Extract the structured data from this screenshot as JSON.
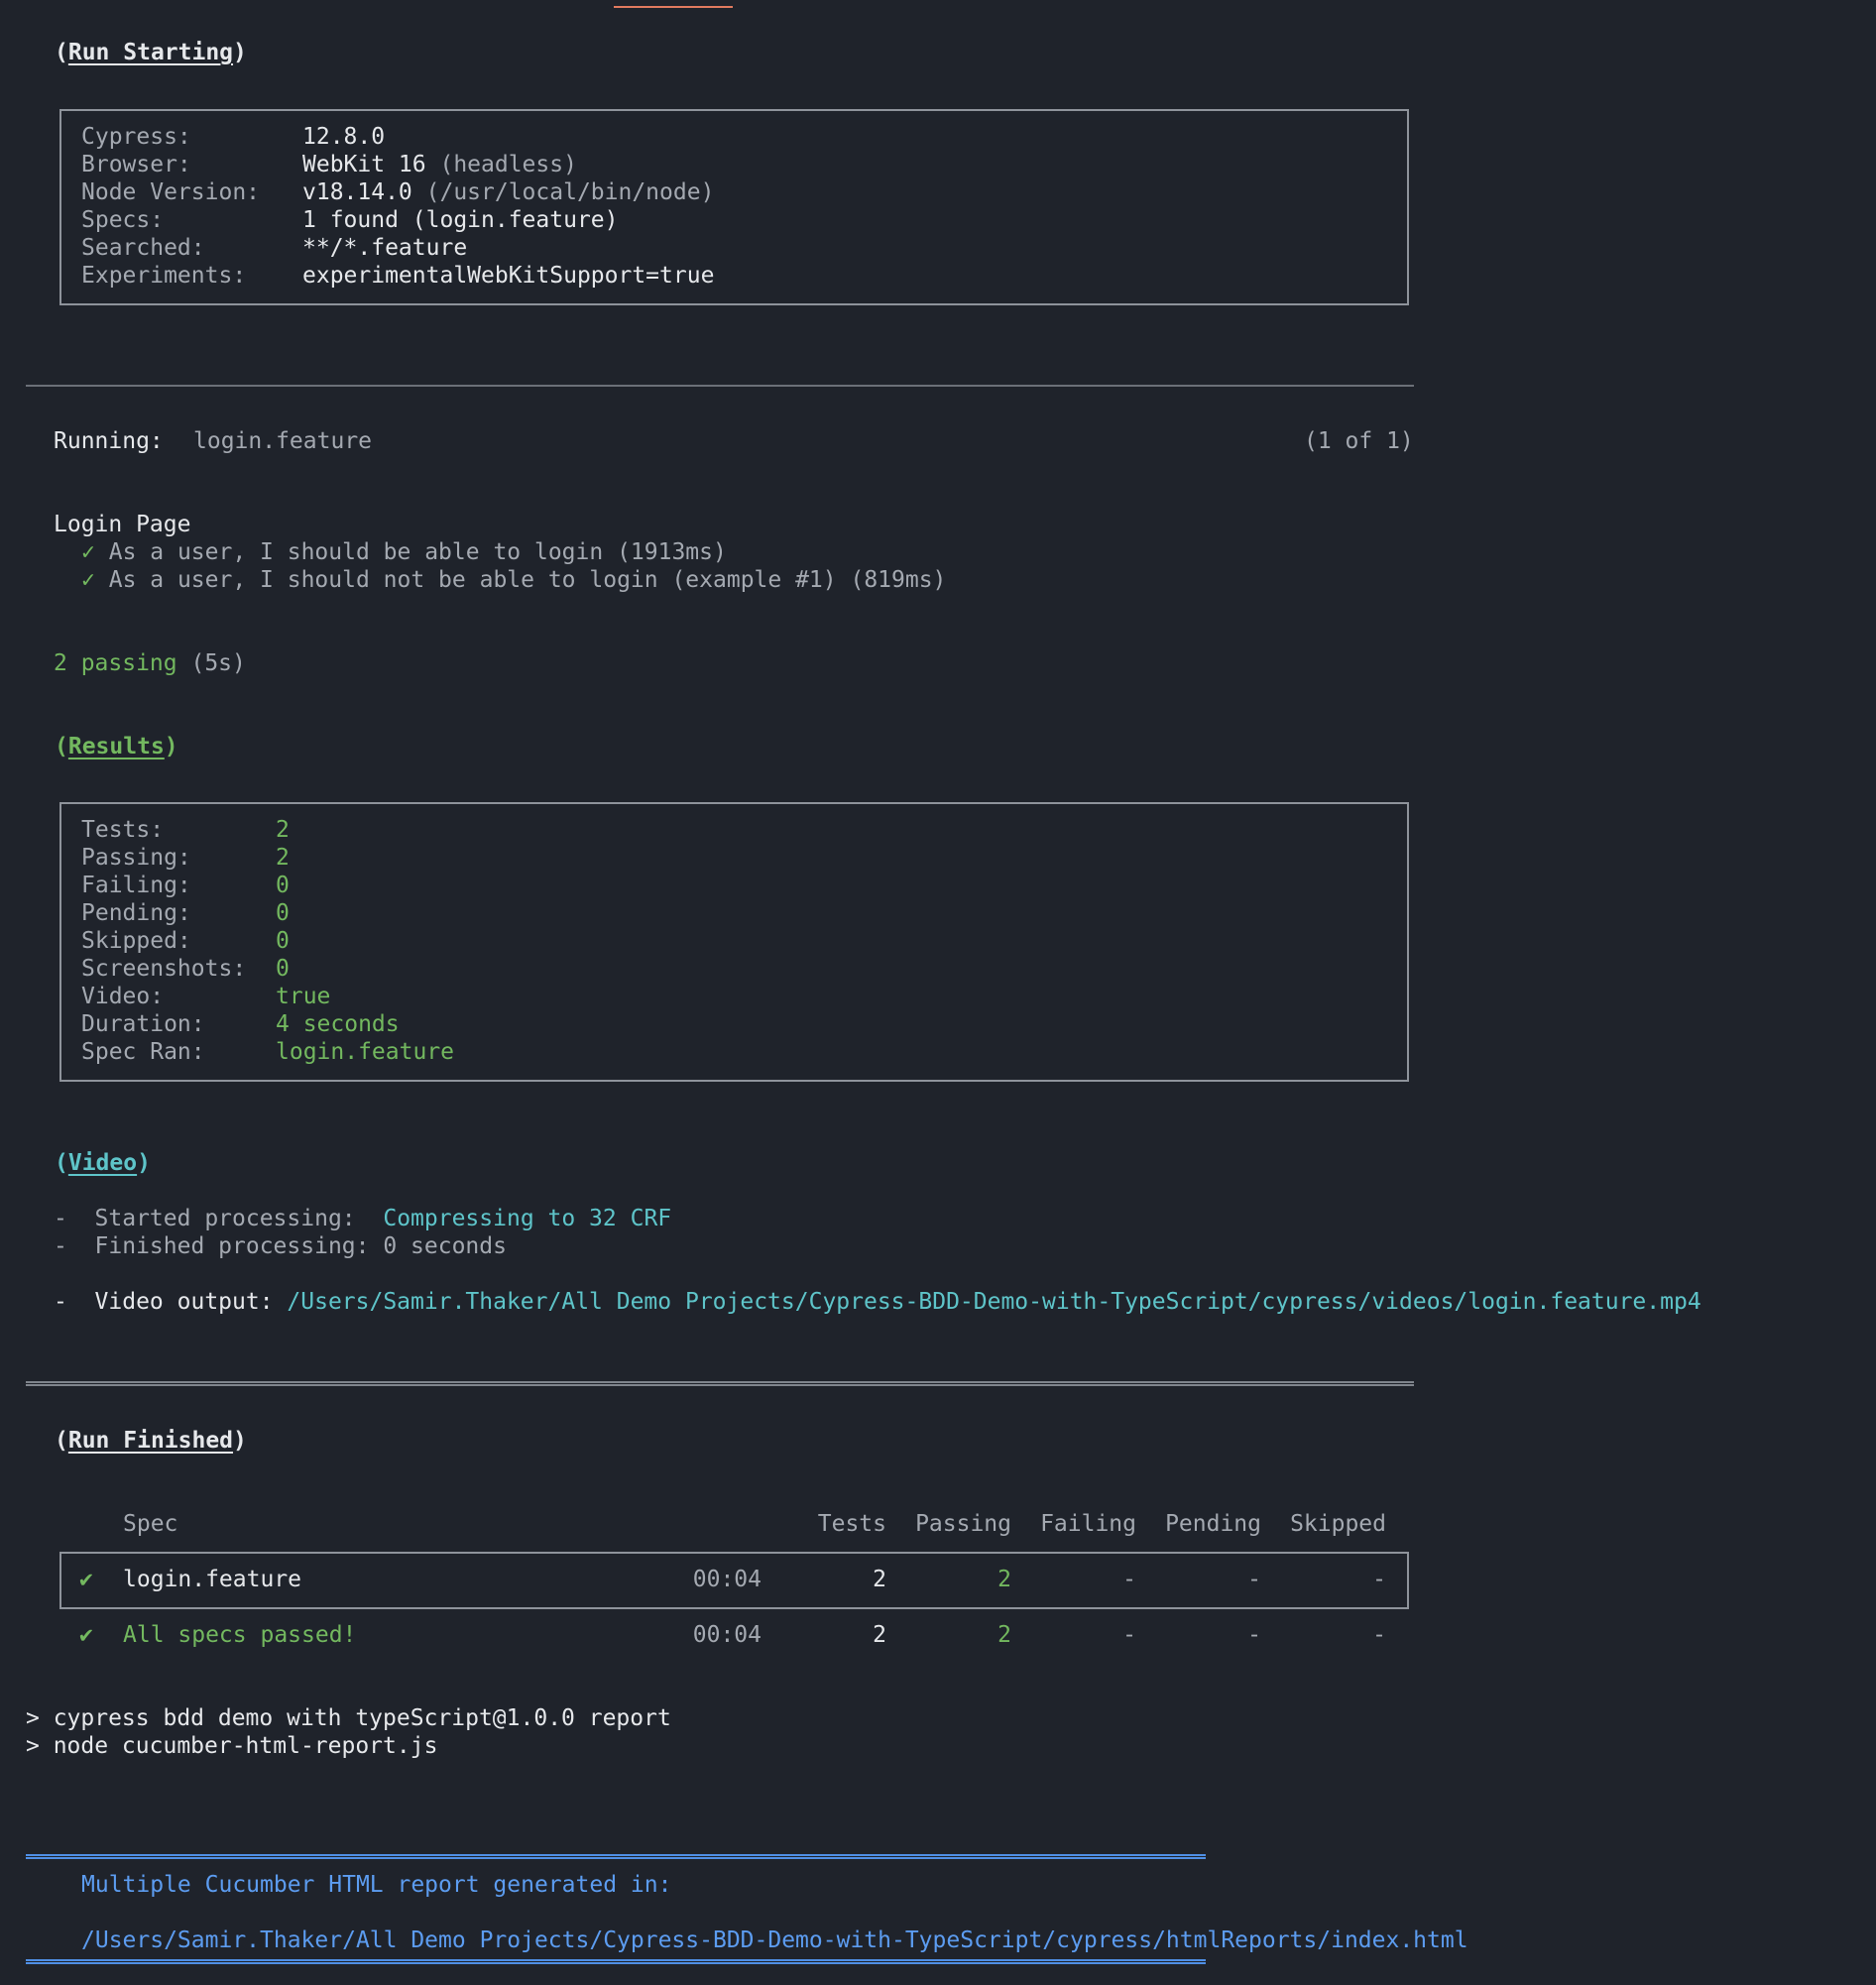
{
  "run_starting": {
    "open": "(",
    "label": "Run Starting",
    "close": ")",
    "rows": [
      {
        "key": "Cypress:",
        "value": "12.8.0",
        "extra": ""
      },
      {
        "key": "Browser:",
        "value": "WebKit 16",
        "extra": " (headless)"
      },
      {
        "key": "Node Version:",
        "value": "v18.14.0",
        "extra": " (/usr/local/bin/node)"
      },
      {
        "key": "Specs:",
        "value": "1 found (login.feature)",
        "extra": ""
      },
      {
        "key": "Searched:",
        "value": "**/*.feature",
        "extra": ""
      },
      {
        "key": "Experiments:",
        "value": "experimentalWebKitSupport=true",
        "extra": ""
      }
    ]
  },
  "running": {
    "label": "Running:",
    "spec": "login.feature",
    "count": "(1 of 1)"
  },
  "suite": {
    "title": "Login Page",
    "tests": [
      {
        "check": "✓",
        "name": "As a user, I should be able to login",
        "time": " (1913ms)"
      },
      {
        "check": "✓",
        "name": "As a user, I should not be able to login (example #1)",
        "time": " (819ms)"
      }
    ]
  },
  "passing_summary": {
    "text": "2 passing",
    "time": " (5s)"
  },
  "results": {
    "open": "(",
    "label": "Results",
    "close": ")",
    "rows": [
      {
        "key": "Tests:",
        "value": "2"
      },
      {
        "key": "Passing:",
        "value": "2"
      },
      {
        "key": "Failing:",
        "value": "0"
      },
      {
        "key": "Pending:",
        "value": "0"
      },
      {
        "key": "Skipped:",
        "value": "0"
      },
      {
        "key": "Screenshots:",
        "value": "0"
      },
      {
        "key": "Video:",
        "value": "true"
      },
      {
        "key": "Duration:",
        "value": "4 seconds"
      },
      {
        "key": "Spec Ran:",
        "value": "login.feature"
      }
    ]
  },
  "video": {
    "open": "(",
    "label": "Video",
    "close": ")",
    "started_label": "-  Started processing:  ",
    "started_value": "Compressing to 32 CRF",
    "finished": "-  Finished processing: 0 seconds",
    "output_label": "-  Video output: ",
    "output_path": "/Users/Samir.Thaker/All Demo Projects/Cypress-BDD-Demo-with-TypeScript/cypress/videos/login.feature.mp4"
  },
  "run_finished": {
    "open": "(",
    "label": "Run Finished",
    "close": ")",
    "headers": {
      "spec": "Spec",
      "tests": "Tests",
      "passing": "Passing",
      "failing": "Failing",
      "pending": "Pending",
      "skipped": "Skipped"
    },
    "spec_row": {
      "check": "✔",
      "spec": "login.feature",
      "time": "00:04",
      "tests": "2",
      "passing": "2",
      "failing": "-",
      "pending": "-",
      "skipped": "-"
    },
    "total_row": {
      "check": "✔",
      "spec": "All specs passed!",
      "time": "00:04",
      "tests": "2",
      "passing": "2",
      "failing": "-",
      "pending": "-",
      "skipped": "-"
    }
  },
  "commands": [
    "> cypress bdd demo with typeScript@1.0.0 report",
    "> node cucumber-html-report.js"
  ],
  "report": {
    "message": "Multiple Cucumber HTML report generated in:",
    "path": "/Users/Samir.Thaker/All Demo Projects/Cypress-BDD-Demo-with-TypeScript/cypress/htmlReports/index.html"
  },
  "colors": {
    "background": "#1f232b",
    "green": "#73b85f",
    "cyan": "#5ec4c9",
    "blue": "#5c9cf0"
  }
}
